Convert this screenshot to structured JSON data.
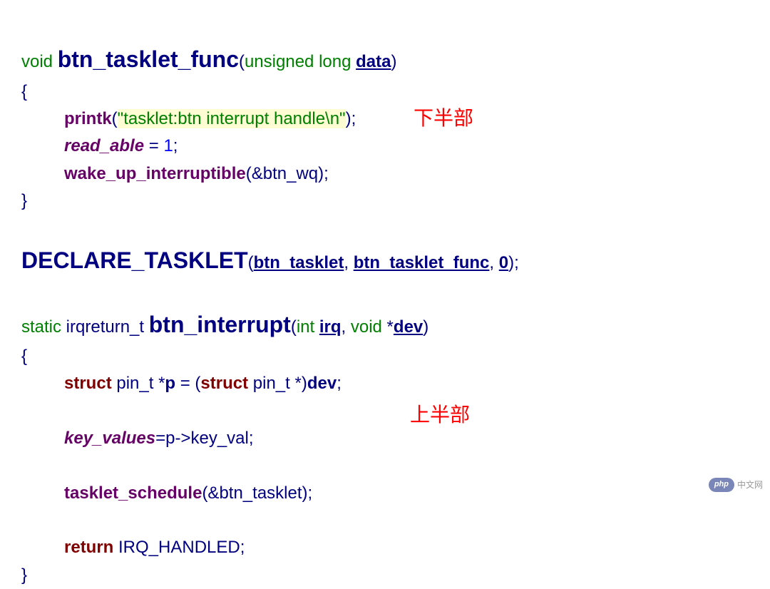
{
  "line1": {
    "void": "void",
    "func": "btn_tasklet_func",
    "paren_open": "(",
    "ulong": "unsigned long",
    "param": "data",
    "paren_close": ")"
  },
  "line2": "{",
  "line3": {
    "printk": "printk",
    "open": "(",
    "str": "\"tasklet:btn interrupt handle\\n\"",
    "close": ");"
  },
  "line4": {
    "lhs": "read_able",
    "eq": " = ",
    "val": "1",
    "semi": ";"
  },
  "line5": {
    "fn": "wake_up_interruptible",
    "args": "(&btn_wq);"
  },
  "line6": "}",
  "annot_bottom_half": "下半部",
  "decl": {
    "macro": "DECLARE_TASKLET",
    "open": "(",
    "a1": "btn_tasklet",
    "c1": ", ",
    "a2": "btn_tasklet_func",
    "c2": ", ",
    "a3": "0",
    "close": ");"
  },
  "line_int": {
    "static": "static",
    "ret": " irqreturn_t ",
    "fn": "btn_interrupt",
    "open": "(",
    "int": "int ",
    "irq": "irq",
    "comma": ", ",
    "void": "void",
    "star": " *",
    "dev": "dev",
    "close": ")"
  },
  "brace_open2": "{",
  "struct_line": {
    "struct1": "struct",
    "t1": " pin_t *",
    "p": "p",
    "eq": " = (",
    "struct2": "struct",
    "t2": " pin_t *)",
    "dev": "dev",
    "semi": ";"
  },
  "kv_line": {
    "lhs": "key_values",
    "rhs": "=p->key_val;"
  },
  "sched_line": {
    "fn": "tasklet_schedule",
    "args": "(&btn_tasklet);"
  },
  "annot_top_half": "上半部",
  "ret_line": {
    "ret": "return",
    "val": " IRQ_HANDLED;"
  },
  "brace_close2": "}",
  "watermark": {
    "badge": "php",
    "text": "中文网"
  }
}
